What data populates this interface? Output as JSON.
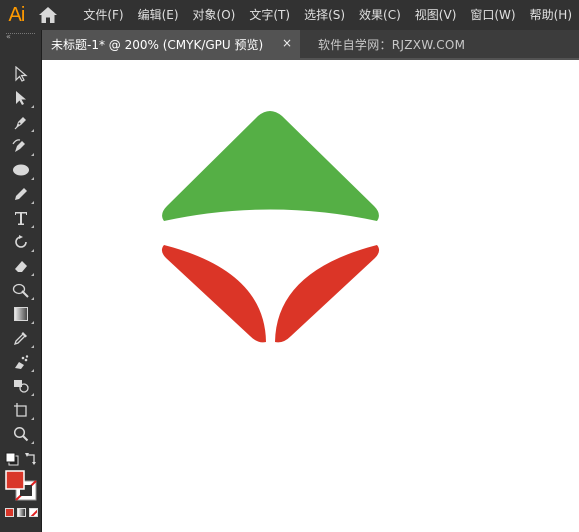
{
  "app": {
    "logo_text": "Ai"
  },
  "menu": {
    "items": [
      {
        "label": "文件(F)"
      },
      {
        "label": "编辑(E)"
      },
      {
        "label": "对象(O)"
      },
      {
        "label": "文字(T)"
      },
      {
        "label": "选择(S)"
      },
      {
        "label": "效果(C)"
      },
      {
        "label": "视图(V)"
      },
      {
        "label": "窗口(W)"
      },
      {
        "label": "帮助(H)"
      }
    ]
  },
  "tabs": {
    "active": {
      "label": "未标题-1* @ 200% (CMYK/GPU 预览)",
      "close": "×"
    },
    "inactive": {
      "label": "软件自学网：RJZXW.COM"
    }
  },
  "toolbar": {
    "collapse": "«",
    "tools": [
      "selection-tool",
      "direct-selection-tool",
      "pen-tool",
      "curvature-tool",
      "ellipse-tool",
      "pencil-tool",
      "type-tool",
      "rotate-tool",
      "eraser-tool",
      "warp-tool",
      "gradient-tool",
      "eyedropper-tool",
      "symbol-sprayer-tool",
      "shape-builder-tool",
      "artboard-tool",
      "zoom-tool"
    ]
  },
  "colors": {
    "menubar": "#323232",
    "fill_swatch": "#d9372a",
    "logo_green": "#55af45",
    "logo_red": "#db3527",
    "ai_orange": "#ff9a00"
  }
}
